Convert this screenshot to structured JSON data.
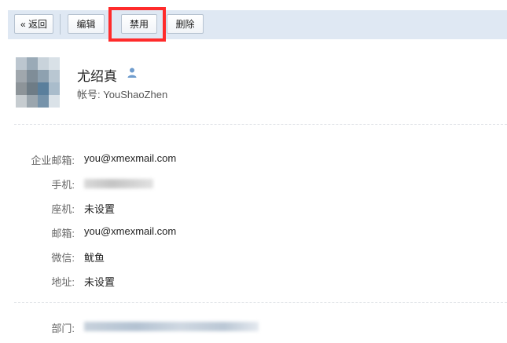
{
  "toolbar": {
    "back_label": "« 返回",
    "edit_label": "编辑",
    "disable_label": "禁用",
    "delete_label": "删除"
  },
  "profile": {
    "name": "尤绍真",
    "account_label": "帐号:",
    "account_value": "YouShaoZhen"
  },
  "fields": {
    "corp_email_label": "企业邮箱:",
    "corp_email_value": "you@xmexmail.com",
    "mobile_label": "手机:",
    "landline_label": "座机:",
    "landline_value": "未设置",
    "email_label": "邮箱:",
    "email_value": "you@xmexmail.com",
    "wechat_label": "微信:",
    "wechat_value": "鱿鱼",
    "address_label": "地址:",
    "address_value": "未设置",
    "department_label": "部门:"
  },
  "colors": {
    "toolbar_bg": "#dfe8f3",
    "highlight": "#ff2b2b"
  }
}
